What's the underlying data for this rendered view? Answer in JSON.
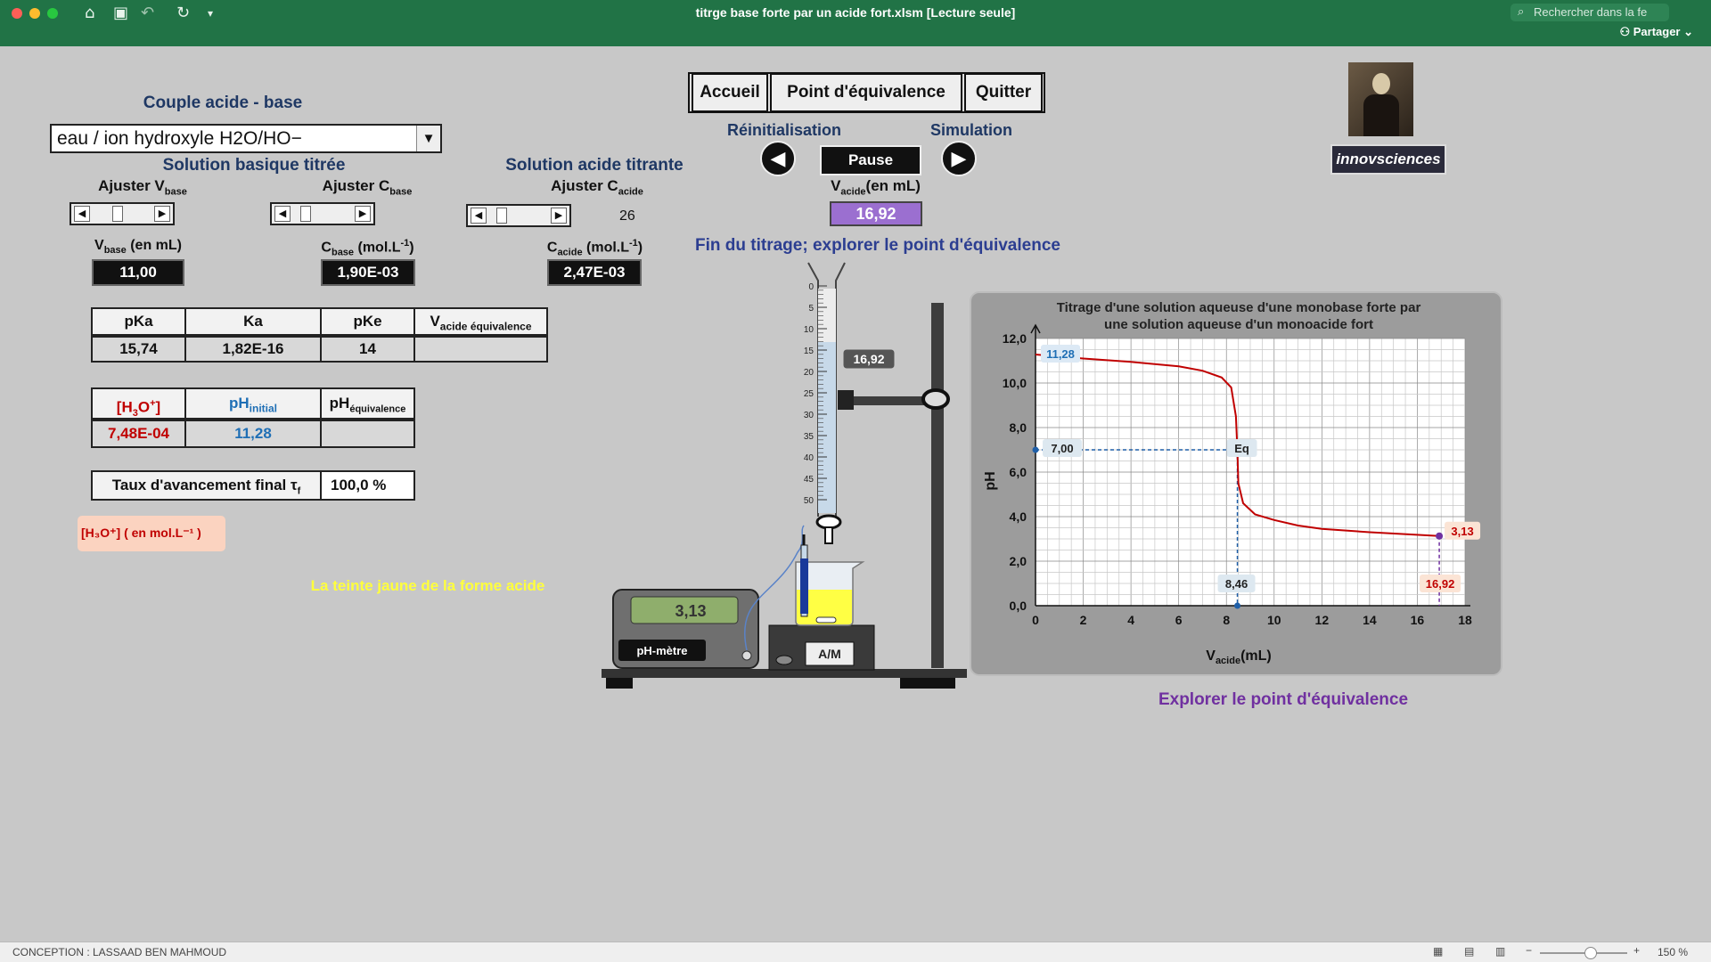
{
  "window": {
    "title": "titrge base forte par un acide fort.xlsm  [Lecture seule]",
    "search_placeholder": "Rechercher dans la fe",
    "share_label": "Partager"
  },
  "nav": {
    "accueil": "Accueil",
    "equivalence": "Point d'équivalence",
    "quitter": "Quitter"
  },
  "couple": {
    "heading": "Couple acide - base",
    "selected": "eau / ion hydroxyle H2O/HO−"
  },
  "titree": {
    "heading": "Solution basique titrée",
    "ajuster_v": "Ajuster V",
    "ajuster_v_sub": "base",
    "ajuster_c": "Ajuster C",
    "ajuster_c_sub": "base"
  },
  "titrante": {
    "heading": "Solution acide titrante",
    "ajuster_c": "Ajuster C",
    "ajuster_c_sub": "acide",
    "slider_value": "26"
  },
  "values": {
    "vbase_label": "V",
    "vbase_sub": "base",
    "vbase_unit": " (en mL)",
    "vbase": "11,00",
    "cbase_label": "C",
    "cbase_sub": "base",
    "cbase_unit": " (mol.L",
    "cbase_sup": "-1",
    "cbase": "1,90E-03",
    "cacide_label": "C",
    "cacide_sub": "acide",
    "cacide_unit": " (mol.L",
    "cacide_sup": "-1",
    "cacide": "2,47E-03"
  },
  "table1": {
    "h_pka": "pKa",
    "h_ka": "Ka",
    "h_pke": "pKe",
    "h_veq": "V",
    "h_veq_sub": "acide équivalence",
    "pka": "15,74",
    "ka": "1,82E-16",
    "pke": "14",
    "veq": ""
  },
  "table2": {
    "h_h3o": "[H",
    "h_h3o_sub": "3",
    "h_h3o_rest": "O",
    "h_h3o_sup": "+",
    "h_h3o_end": "]",
    "h_phi": "pH",
    "h_phi_sub": "initial",
    "h_phe": "pH",
    "h_phe_sub": "équivalence",
    "h3o": "7,48E-04",
    "phi": "11,28",
    "phe": ""
  },
  "taux": {
    "label": "Taux d'avancement final τ",
    "label_sub": "f",
    "value": "100,0 %"
  },
  "note": {
    "text": "[H₃O⁺] ( en mol.L⁻¹ )"
  },
  "teinte": "La teinte jaune de la forme acide",
  "sim": {
    "reinit": "Réinitialisation",
    "simulation": "Simulation",
    "pause": "Pause",
    "vacide_label": "V",
    "vacide_sub": "acide",
    "vacide_unit": "(en mL)",
    "vacide": "16,92",
    "message": "Fin du titrage; explorer le point d'équivalence"
  },
  "burette": {
    "graduations": [
      "0",
      "5",
      "10",
      "15",
      "20",
      "25",
      "30",
      "35",
      "40",
      "45",
      "50"
    ],
    "tag": "16,92"
  },
  "phmetre": {
    "reading": "3,13",
    "label": "pH-mètre",
    "stirrer": "A/M"
  },
  "logo": {
    "text": "innovsciences"
  },
  "explore": "Explorer le point d'équivalence",
  "status": {
    "left": "CONCEPTION : LASSAAD BEN MAHMOUD",
    "zoom": "150 %"
  },
  "colors": {
    "excel_green": "#217346",
    "navy": "#1f3864",
    "red": "#c00000",
    "blue": "#1f6fb5",
    "purple": "#7030a0",
    "yellow": "#ffff3c"
  },
  "chart_data": {
    "type": "line",
    "title": [
      "Titrage d'une solution aqueuse d'une monobase forte par",
      "une solution aqueuse d'un monoacide fort"
    ],
    "xlabel_main": "V",
    "xlabel_sub": "acide",
    "xlabel_unit": "(mL)",
    "ylabel": "pH",
    "xlim": [
      0,
      18
    ],
    "ylim": [
      0,
      12
    ],
    "xticks": [
      "0",
      "2",
      "4",
      "6",
      "8",
      "10",
      "12",
      "14",
      "16",
      "18"
    ],
    "yticks": [
      "0,0",
      "2,0",
      "4,0",
      "6,0",
      "8,0",
      "10,0",
      "12,0"
    ],
    "grid": true,
    "series": [
      {
        "name": "",
        "color": "#c00000",
        "x": [
          0,
          2,
          4,
          6,
          7,
          7.8,
          8.2,
          8.4,
          8.46,
          8.5,
          8.7,
          9.2,
          10,
          11,
          12,
          14,
          16.92
        ],
        "y": [
          11.28,
          11.1,
          10.95,
          10.75,
          10.55,
          10.25,
          9.8,
          8.5,
          7.0,
          5.5,
          4.6,
          4.1,
          3.85,
          3.6,
          3.45,
          3.3,
          3.13
        ]
      }
    ],
    "annotations": {
      "ph_initial": "11,28",
      "ph_eq": "7,00",
      "eq": "Eq",
      "v_eq": "8,46",
      "ph_final": "3,13",
      "v_final": "16,92"
    }
  }
}
